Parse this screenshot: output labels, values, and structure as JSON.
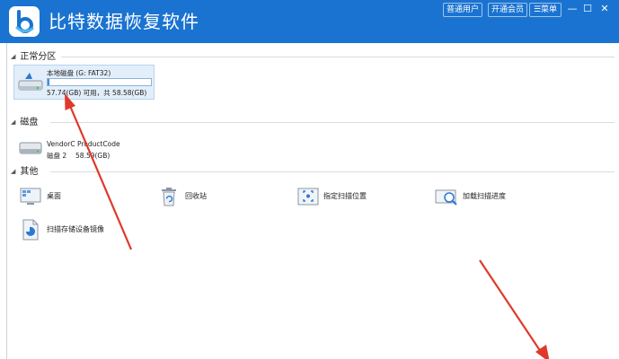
{
  "app": {
    "title": "比特数据恢复软件"
  },
  "top_buttons": {
    "normal_user": "普通用户",
    "vip": "开通会员",
    "menu": "菜单"
  },
  "window_controls": {
    "minimize": "—",
    "maximize": "☐",
    "close": "✕"
  },
  "sections": {
    "normal_partition": "正常分区",
    "disk": "磁盘",
    "other": "其他"
  },
  "partition": {
    "name": "本地磁盘 (G: FAT32)",
    "size_text": "57.74(GB) 可用，共 58.58(GB)",
    "used_fraction": 0.015
  },
  "disk": {
    "model": "VendorC ProductCode",
    "info": "磁盘 2　 58.59(GB)"
  },
  "others": {
    "desktop": "桌面",
    "recycle_bin": "回收站",
    "specified_location": "指定扫描位置",
    "load_progress": "加载扫描进度",
    "scan_image": "扫描存储设备镜像"
  },
  "colors": {
    "titlebar": "#1a73d0",
    "accent": "#3f8de0",
    "arrow": "#e0392b"
  }
}
